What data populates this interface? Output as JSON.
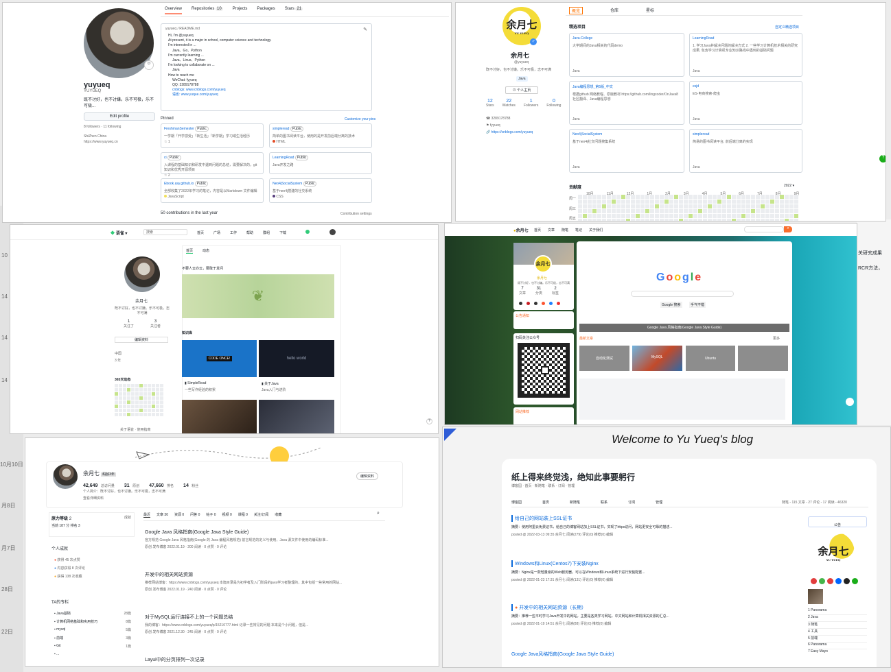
{
  "gh": {
    "tabs": [
      "Overview",
      "Repositories",
      "Projects",
      "Packages",
      "Stars"
    ],
    "repo_count": "10",
    "stars_count": "21",
    "name": "yuyueq",
    "login": "YUYUEQ",
    "bio": "既不讨好，也不讨嫌。乐不可极，乐不可极...",
    "edit_profile": "Edit profile",
    "followers": "8 followers · 11 following",
    "location": "ShiZhen China",
    "website": "https://www.yuyueq.cn",
    "readme_path": "yuyueq / README.md",
    "readme_lines": [
      "Hi, I'm @yuyueq",
      "At present, it is a major in school, computer science and technology.",
      "I'm interested in ...",
      "Java、Go、Python",
      "I'm currently learning ...",
      "Java、Linux、Python",
      "I'm looking to collaborate on ...",
      "Java",
      "How to reach me",
      "WeChat: fyyueq",
      "QQ: 3289178788",
      "cnblogs: www.cnblogs.com/yuyueq",
      "语雀: www.yuque.com/yuyueq"
    ],
    "pinned_label": "Pinned",
    "customize": "Customize your pins",
    "pinned": [
      {
        "name": "FreshmanSemester",
        "badge": "Public",
        "desc": "一学期「开学感受」「新生活」「新学期」学习或生活经历",
        "stars": "1"
      },
      {
        "name": "simpleread",
        "badge": "Public",
        "desc": "简单的图书阅读平台，使用的是开发前后端分离的技术",
        "lang": "HTML"
      },
      {
        "name": "ci",
        "badge": "Public",
        "desc": "入课程的基础知识和研发中遇到问题的总结，需要解决的，git知识和优秀开源项目",
        "stars": "2"
      },
      {
        "name": "LearningRoad",
        "badge": "Public",
        "desc": "Java开发之路"
      },
      {
        "name": "Ebook.asy.github.io",
        "badge": "Public",
        "desc": "全部收集了2022年学习的笔记，内容是以Markdown 文件编辑",
        "lang": "JavaScript"
      },
      {
        "name": "Neo4jSocialSystem",
        "badge": "Public",
        "desc": "基于neo4j搭建的社交系统",
        "lang": "CSS"
      }
    ],
    "contrib": "50 contributions in the last year",
    "contrib_settings": "Contribution settings"
  },
  "gitee": {
    "tabs": [
      "概览",
      "仓库",
      "星标"
    ],
    "logo_text": "余月七",
    "logo_sub": "YU YUEQ",
    "name": "余月七",
    "login": "@yuyueq",
    "bio": "既不讨好，也不讨嫌。乐不可极，志不可满",
    "tag": "Java",
    "profile_btn": "个人主页",
    "stats": [
      {
        "n": "12",
        "l": "Stars"
      },
      {
        "n": "22",
        "l": "Watches"
      },
      {
        "n": "1",
        "l": "Followers"
      },
      {
        "n": "0",
        "l": "Following"
      }
    ],
    "qq": "3289178788",
    "org": "fyyueq",
    "blog": "https://cnblogs.com/yuyueq",
    "featured_label": "精选项目",
    "customize": "自定义精选项目",
    "projects": [
      {
        "name": "Java-College",
        "desc": "大学期间的Java相关的代码demo",
        "lang": "Java"
      },
      {
        "name": "LearningRoad",
        "desc": "1. 学习Java并解决问题的解决方式 2. 一些学习计算机技术相关的研究成果, 包含学习计算机专业知识路线中遇到的基础问题",
        "lang": "Java"
      },
      {
        "name": "Java编程思想_第5版_中文",
        "desc": "根据github 网络教程、原版教材 https://github.com/lingcoder/OnJava8 社区翻译、Java编程思想",
        "lang": "Java"
      },
      {
        "name": "esjd",
        "desc": "ES-电商搜索-爬虫",
        "lang": "Java"
      },
      {
        "name": "Neo4jSocialSystem",
        "desc": "基于neo4j社交问题搜集系统",
        "lang": "Java"
      },
      {
        "name": "simpleread",
        "desc": "简易的图书阅读平台, 前后端分离的实现",
        "lang": "Java"
      }
    ],
    "contrib_label": "贡献度",
    "year": "2022",
    "months": [
      "10月",
      "11月",
      "12月",
      "1月",
      "2月",
      "3月",
      "4月",
      "5月",
      "6月",
      "7月",
      "8月",
      "9月"
    ],
    "weekdays": [
      "周一",
      "周三",
      "周五"
    ]
  },
  "yuque": {
    "logo": "语雀",
    "search_placeholder": "搜索",
    "nav": [
      "首页",
      "广场",
      "工作",
      "帮助",
      "群组",
      "下载"
    ],
    "user": "余月七",
    "bio": "既不讨好，也不讨嫌。乐不可极，志不可满",
    "stats": [
      {
        "n": "1",
        "l": "关注了"
      },
      {
        "n": "3",
        "l": "关注者"
      }
    ],
    "edit_btn": "编辑资料",
    "meta": [
      "中国",
      "3 年"
    ],
    "heat_label": "365天动态",
    "tabs": [
      "首页",
      "动态"
    ],
    "quote": "不要人云亦云，要敢于发问",
    "kb_label": "知识库",
    "cards": [
      {
        "cover": "CODE ONCE!",
        "name": "SimpleRead",
        "desc": "一些写作经验的积累"
      },
      {
        "cover": "hello world",
        "name": "关于Java",
        "desc": "Java入门与进阶"
      }
    ],
    "footer": "关于语雀 · 使用指南"
  },
  "blog7": {
    "logo": "余月七",
    "nav": [
      "首页",
      "文章",
      "随笔",
      "笔记",
      "关于我们"
    ],
    "name": "余月七",
    "bio": "既不讨好，也不讨嫌。乐不可极，志不可满",
    "stats": [
      {
        "n": "7",
        "l": "文章"
      },
      {
        "n": "31",
        "l": "分类"
      },
      {
        "n": "2",
        "l": "标签"
      }
    ],
    "notice": "公告通知",
    "qr_label": "扫码关注公众号",
    "ext_label": "网站推荐",
    "google_caption": "Google Java 风格指南(Google Java Style Guide)",
    "google_letters": [
      "G",
      "o",
      "o",
      "g",
      "l",
      "e"
    ],
    "google_btn1": "Google 搜索",
    "google_btn2": "手气不错",
    "latest": "最新文章",
    "more": "更多",
    "thumbs": [
      "自动化测试",
      "MySQL",
      "Ubuntu",
      ""
    ]
  },
  "csdn": {
    "name": "余月七",
    "level": "码龄3年",
    "stats": [
      {
        "n": "42,649",
        "l": "总访问量"
      },
      {
        "n": "31",
        "l": "原创"
      },
      {
        "n": "47,660",
        "l": "排名"
      },
      {
        "n": "14",
        "l": "粉丝"
      }
    ],
    "bio": "个人简介：既不讨好，也不讨嫌。乐不可极，志不可满",
    "detail_link": "查看详细资料",
    "edit_btn": "编辑资料",
    "power_label": "原力等级",
    "power_level": "2",
    "power_rank": "成就",
    "power_sub": "当前 187 分  排名 3",
    "achievements_label": "个人成就",
    "achievements": [
      "获得 45 次点赞",
      "内容获得 8 次评论",
      "获得 138 次收藏"
    ],
    "tags_label": "TA的专栏",
    "tags": [
      {
        "n": "Java基础",
        "c": "28篇"
      },
      {
        "n": "计算机网络基础和实用技巧",
        "c": "8篇"
      },
      {
        "n": "mysql",
        "c": "5篇"
      },
      {
        "n": "前端",
        "c": "3篇"
      },
      {
        "n": "Git",
        "c": "1篇"
      },
      {
        "n": "...",
        "c": ""
      }
    ],
    "tabs": [
      "最近",
      "文章",
      "资源",
      "问答",
      "帖子",
      "视频",
      "课程",
      "关注/订阅",
      "收藏"
    ],
    "tab_counts": [
      "",
      "30",
      "0",
      "0",
      "0",
      "0",
      "0",
      "",
      ""
    ],
    "posts": [
      {
        "title": "Google Java 风格指南(Google Java Style Guide)",
        "desc": "官方规范 Google Java 风格指南(Google 的 Java 编程风格规范) 前言规范的定义与使用，Java 源文件中使用的编码标准...",
        "meta": "原创  发布博客 2022.01.19 · 200 阅读 · 0 点赞 · 0 评论"
      },
      {
        "title": "开发中的相关网站资源",
        "desc": "推荐网站博客：https://www.cnblogs.com/yuyueq 本篇目录是为初学者及入门阶段的java学习者整理的，其中包括一些常用的网站...",
        "meta": "原创  发布博客 2022.01.19 · 240 阅读 · 0 点赞 · 0 评论"
      },
      {
        "title": "对于MySQL运行连接不上的一个问题总结",
        "desc": "我的博客：https://www.cnblogs.com/yuyueq/p/15210777.html 记录一些常见的问题 本来是个小问题，但是...",
        "meta": "原创  发布博客 2021.12.30 · 245 阅读 · 0 点赞 · 0 评论"
      },
      {
        "title": "Layui中的分页排列一次记录",
        "desc": "",
        "meta": ""
      }
    ]
  },
  "cnblogs": {
    "welcome": "Welcome to Yu Yueq's blog",
    "title": "纸上得来终觉浅，绝知此事要躬行",
    "sub": "博客园 · 首页 · 新随笔 · 联系 · 订阅 · 管理",
    "nav": [
      "博客园",
      "首页",
      "新随笔",
      "联系",
      "订阅",
      "管理"
    ],
    "stats_text": "随笔 - 115  文章 - 27  评论 - 17  阅读 - 46320",
    "notice": "公告",
    "logo": "余月七",
    "logo_sub": "YU YUEQ",
    "posts": [
      {
        "title": "给自己的网站装上SSL证书",
        "desc": "摘要：使用阿里云免费证书，给自己的博客网站加上SSL证书，实现了https访问，网站更安全可靠的描述...",
        "meta": "posted @ 2022-03-13 09:35 余月七 阅读(279) 评论(0) 推荐(0) 编辑"
      },
      {
        "title": "Windows和Linux(Centos7)下安装Nginx",
        "desc": "摘要：Nginx是一款轻量级的Web服务器，可以在Windows和Linux系统下进行安装配置...",
        "meta": "posted @ 2022-01-23 17:31 余月七 阅读(131) 评论(0) 推荐(0) 编辑"
      },
      {
        "title": "开发中的相关网站资源（长期）",
        "desc": "摘要：推荐一些平时学习Java开发中的网站，主要是各类学习网站，中文网站和计算机相关资源的汇总...",
        "meta": "posted @ 2022-01-19 14:51 余月七 阅读(88) 评论(0) 推荐(0) 编辑"
      },
      {
        "title": "Google Java风格指南(Google Java Style Guide)",
        "desc": "",
        "meta": ""
      }
    ],
    "rank": [
      {
        "n": "Panorama",
        "r": "1"
      },
      {
        "n": "Java",
        "r": "2"
      },
      {
        "n": "随笔",
        "r": "3"
      },
      {
        "n": "工具",
        "r": "4"
      },
      {
        "n": "前端",
        "r": "5"
      },
      {
        "n": "Panorama",
        "r": "6"
      },
      {
        "n": "Easy Mayo",
        "r": "7"
      }
    ]
  },
  "bg_dates": [
    "10",
    "14",
    "14",
    "14",
    "10月10日",
    "月8日",
    "月7日",
    "28日",
    "22日"
  ],
  "bg_right_text": [
    "关研究成果",
    "RCR方法，"
  ]
}
